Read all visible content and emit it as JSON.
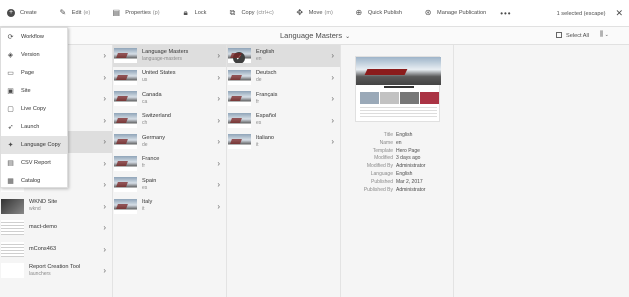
{
  "toolbar": {
    "create": "Create",
    "edit": "Edit",
    "edit_shortcut": "(e)",
    "properties": "Properties",
    "properties_shortcut": "(p)",
    "lock": "Lock",
    "copy": "Copy",
    "copy_shortcut": "(ctrl+c)",
    "move": "Move",
    "move_shortcut": "(m)",
    "quick_publish": "Quick Publish",
    "manage_publication": "Manage Publication",
    "more": "•••",
    "selection": "1 selected (escape)",
    "close": "✕"
  },
  "header": {
    "title": "Language Masters",
    "select_all": "Select All"
  },
  "create_menu": [
    {
      "label": "Workflow",
      "icon": "workflow-icon",
      "glyph": "⟳"
    },
    {
      "label": "Version",
      "icon": "layers-icon",
      "glyph": "◈"
    },
    {
      "label": "Page",
      "icon": "page-icon",
      "glyph": "▭"
    },
    {
      "label": "Site",
      "icon": "site-icon",
      "glyph": "▣"
    },
    {
      "label": "Live Copy",
      "icon": "live-copy-icon",
      "glyph": "▢"
    },
    {
      "label": "Launch",
      "icon": "rocket-icon",
      "glyph": "➶"
    },
    {
      "label": "Language Copy",
      "icon": "globe-icon",
      "glyph": "✦"
    },
    {
      "label": "CSV Report",
      "icon": "csv-icon",
      "glyph": "▤"
    },
    {
      "label": "Catalog",
      "icon": "catalog-icon",
      "glyph": "▦"
    }
  ],
  "column0": [
    {
      "title": "",
      "sub": "…-mo…"
    },
    {
      "title": "",
      "sub": ""
    },
    {
      "title": "",
      "sub": ""
    },
    {
      "title": "",
      "sub": ""
    },
    {
      "title": "",
      "sub": ""
    },
    {
      "title": "",
      "sub": ""
    },
    {
      "title": "",
      "sub": ""
    },
    {
      "title": "WKND Site",
      "sub": "wknd"
    },
    {
      "title": "mact-demo",
      "sub": ""
    },
    {
      "title": "mCons463",
      "sub": ""
    },
    {
      "title": "Report Creation Tool",
      "sub": "launchers"
    }
  ],
  "column1": [
    {
      "title": "Language Masters",
      "sub": "language-masters"
    },
    {
      "title": "United States",
      "sub": "us"
    },
    {
      "title": "Canada",
      "sub": "ca"
    },
    {
      "title": "Switzerland",
      "sub": "ch"
    },
    {
      "title": "Germany",
      "sub": "de"
    },
    {
      "title": "France",
      "sub": "fr"
    },
    {
      "title": "Spain",
      "sub": "es"
    },
    {
      "title": "Italy",
      "sub": "it"
    }
  ],
  "column2": [
    {
      "title": "English",
      "sub": "en"
    },
    {
      "title": "Deutsch",
      "sub": "de"
    },
    {
      "title": "Français",
      "sub": "fr"
    },
    {
      "title": "Español",
      "sub": "es"
    },
    {
      "title": "Italiano",
      "sub": "it"
    }
  ],
  "preview_meta": [
    {
      "k": "Title",
      "v": "English"
    },
    {
      "k": "Name",
      "v": "en"
    },
    {
      "k": "Template",
      "v": "Hero Page"
    },
    {
      "k": "Modified",
      "v": "3 days ago"
    },
    {
      "k": "Modified By",
      "v": "Administrator"
    },
    {
      "k": "Language",
      "v": "English"
    },
    {
      "k": "Published",
      "v": "Mar 2, 2017"
    },
    {
      "k": "Published By",
      "v": "Administrator"
    }
  ]
}
